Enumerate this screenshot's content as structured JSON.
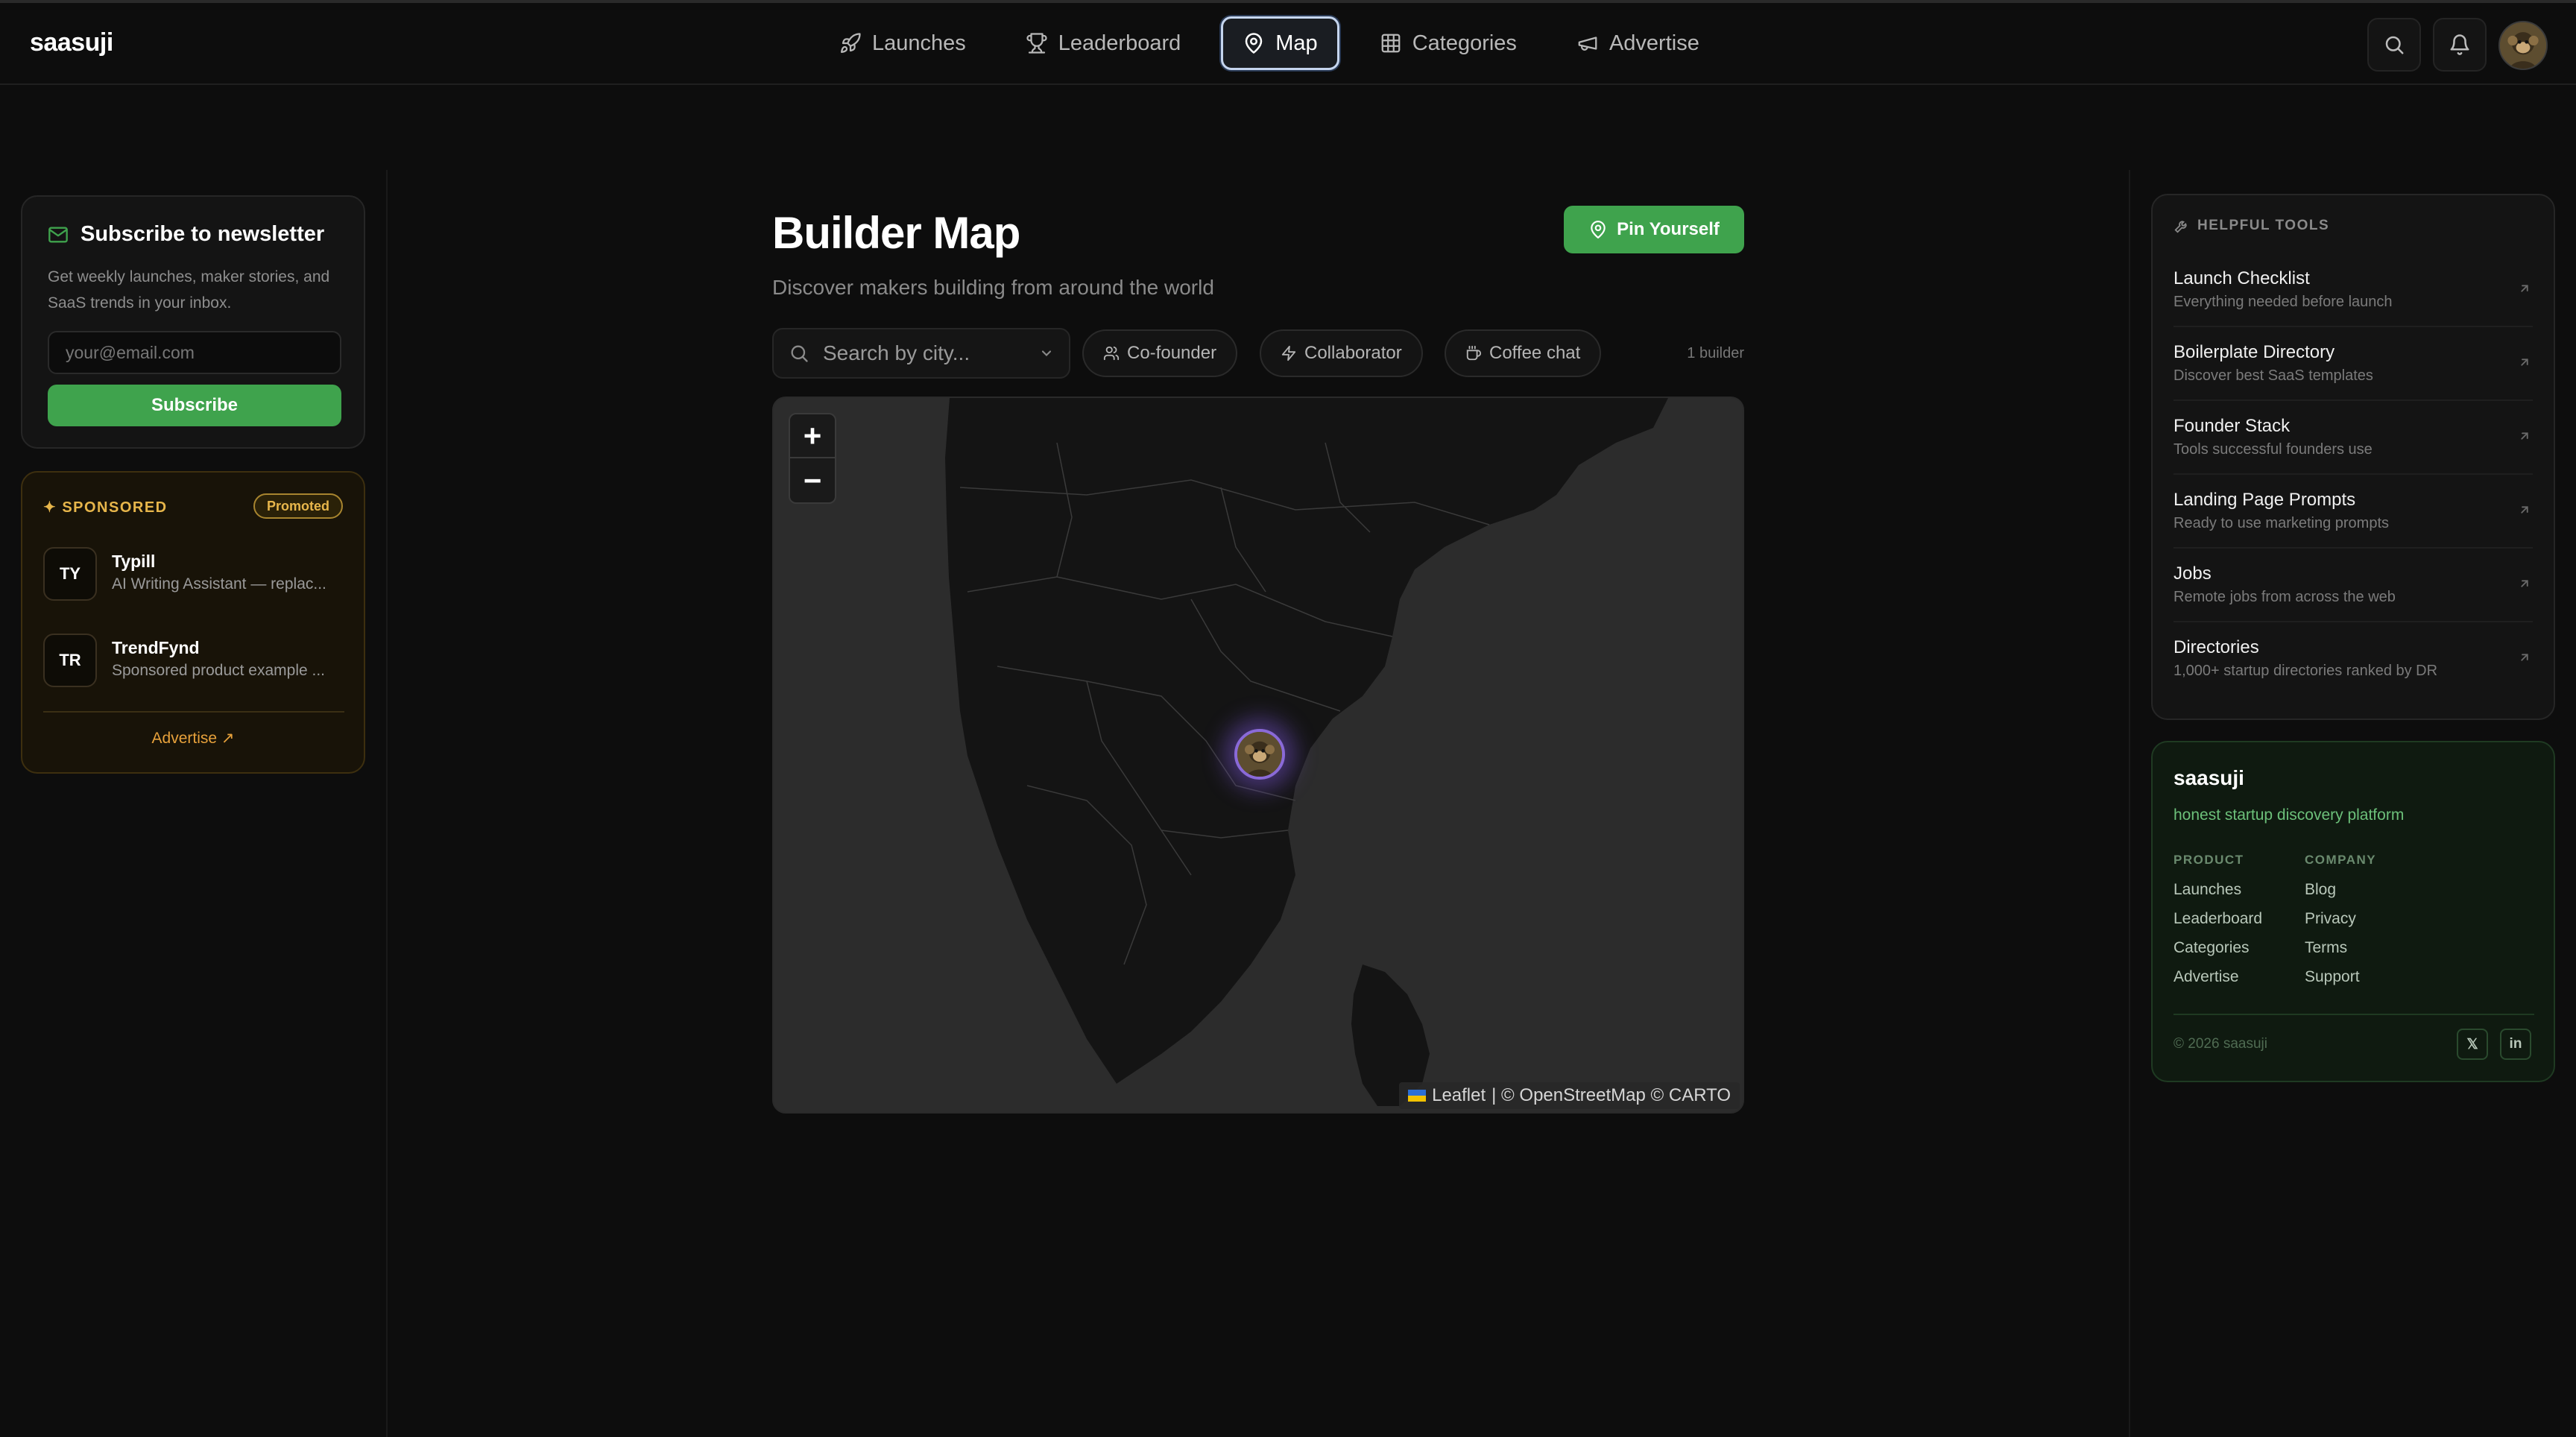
{
  "app": {
    "brand": "saasuji"
  },
  "nav": {
    "items": [
      {
        "label": "Launches",
        "icon": "rocket-icon"
      },
      {
        "label": "Leaderboard",
        "icon": "trophy-icon"
      },
      {
        "label": "Map",
        "icon": "map-pin-icon",
        "active": true
      },
      {
        "label": "Categories",
        "icon": "grid-icon"
      },
      {
        "label": "Advertise",
        "icon": "megaphone-icon"
      }
    ]
  },
  "header_actions": {
    "search_icon": "search-icon",
    "bell_icon": "bell-icon",
    "avatar": "user-avatar"
  },
  "newsletter": {
    "title": "Subscribe to newsletter",
    "description": "Get weekly launches, maker stories, and SaaS trends in your inbox.",
    "placeholder": "your@email.com",
    "button": "Subscribe"
  },
  "sponsored": {
    "label": "✦ SPONSORED",
    "badge": "Promoted",
    "items": [
      {
        "initials": "TY",
        "name": "Typill",
        "description": "AI Writing Assistant — replac..."
      },
      {
        "initials": "TR",
        "name": "TrendFynd",
        "description": "Sponsored product example ..."
      }
    ],
    "advertise_link": "Advertise ↗"
  },
  "main": {
    "title": "Builder Map",
    "subtitle": "Discover makers building from around the world",
    "pin_button": "Pin Yourself",
    "search_placeholder": "Search by city...",
    "filters": [
      "Co-founder",
      "Collaborator",
      "Coffee chat"
    ],
    "builder_count": "1 builder"
  },
  "map": {
    "zoom_in": "+",
    "zoom_out": "−",
    "attribution_leaflet": "Leaflet",
    "attribution_rest": "| © OpenStreetMap © CARTO",
    "marker": "builder-avatar-marker"
  },
  "tools": {
    "heading": "HELPFUL TOOLS",
    "items": [
      {
        "name": "Launch Checklist",
        "description": "Everything needed before launch"
      },
      {
        "name": "Boilerplate Directory",
        "description": "Discover best SaaS templates"
      },
      {
        "name": "Founder Stack",
        "description": "Tools successful founders use"
      },
      {
        "name": "Landing Page Prompts",
        "description": "Ready to use marketing prompts"
      },
      {
        "name": "Jobs",
        "description": "Remote jobs from across the web"
      },
      {
        "name": "Directories",
        "description": "1,000+ startup directories ranked by DR"
      }
    ]
  },
  "footer": {
    "brand": "saasuji",
    "tagline": "honest startup discovery platform",
    "product_heading": "PRODUCT",
    "product_links": [
      "Launches",
      "Leaderboard",
      "Categories",
      "Advertise"
    ],
    "company_heading": "COMPANY",
    "company_links": [
      "Blog",
      "Privacy",
      "Terms",
      "Support"
    ],
    "copyright": "© 2026 saasuji",
    "social": [
      "𝕏",
      "in"
    ]
  },
  "colors": {
    "accent_green": "#3fa34d",
    "sponsor_gold": "#e7b64b",
    "marker_glow": "#8a6ad8"
  }
}
